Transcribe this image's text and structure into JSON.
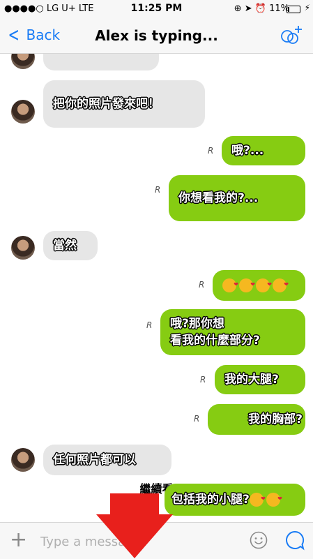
{
  "status_bar": {
    "carrier": "●●●●○ LG U+  LTE",
    "time": "11:25 PM",
    "battery": "11%",
    "battery_level": 0.11
  },
  "nav": {
    "back_label": "Back",
    "title": "Alex is typing..."
  },
  "messages": [
    {
      "dir": "in",
      "text": ""
    },
    {
      "dir": "in",
      "text": "把你的照片發來吧！"
    },
    {
      "dir": "out",
      "text": "哦?...",
      "receipt": "R"
    },
    {
      "dir": "out",
      "text": "你想看我的?...",
      "receipt": "R"
    },
    {
      "dir": "in",
      "text": "當然"
    },
    {
      "dir": "out",
      "text": "",
      "emoji": [
        "kissing-heart-emoji",
        "kissing-heart-emoji",
        "kissing-heart-emoji",
        "kissing-heart-emoji"
      ],
      "receipt": "R"
    },
    {
      "dir": "out",
      "text": "哦?那你想",
      "text2": "看我的什麼部分?",
      "receipt": "R"
    },
    {
      "dir": "out",
      "text": "我的大腿?",
      "receipt": "R"
    },
    {
      "dir": "out",
      "text": "我的胸部?",
      "receipt": "R"
    },
    {
      "dir": "in",
      "text": "任何照片都可以"
    },
    {
      "dir": "out",
      "text": "包括我的小腿?",
      "emoji": [
        "kissing-heart-emoji",
        "kissing-heart-emoji"
      ]
    }
  ],
  "overlay": {
    "continue_label": "繼續看"
  },
  "input": {
    "placeholder": "Type a message"
  },
  "colors": {
    "accent": "#1a7cf5",
    "outgoing": "#86cc12",
    "incoming": "#e6e6e6",
    "arrow": "#e8201c"
  }
}
